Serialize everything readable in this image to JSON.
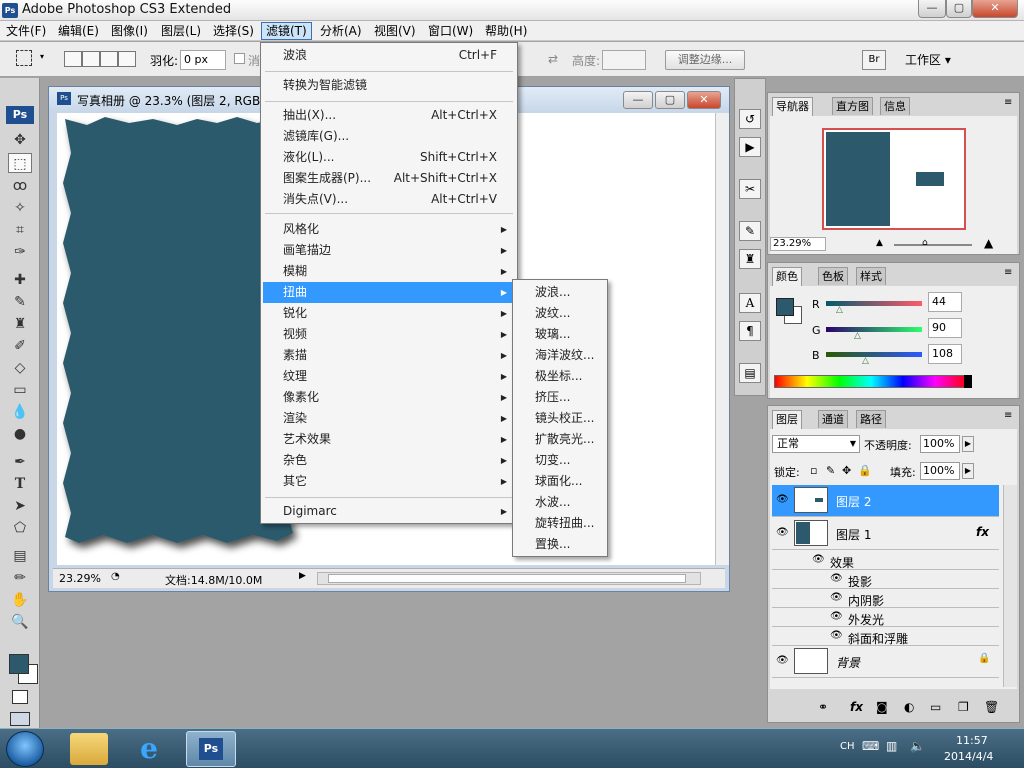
{
  "app": {
    "title": "Adobe Photoshop CS3 Extended",
    "logo": "Ps"
  },
  "window_controls": {
    "minimize": "—",
    "maximize": "▢",
    "close": "✕"
  },
  "menubar": [
    "文件(F)",
    "编辑(E)",
    "图像(I)",
    "图层(L)",
    "选择(S)",
    "滤镜(T)",
    "分析(A)",
    "视图(V)",
    "窗口(W)",
    "帮助(H)"
  ],
  "options": {
    "feather_label": "羽化:",
    "feather_value": "0 px",
    "antialias": "消",
    "height_label": "高度:",
    "refine_edge": "调整边缘...",
    "workspace": "工作区 ▾"
  },
  "document": {
    "title": "写真相册 @ 23.3% (图层 2, RGB/",
    "zoom": "23.29%",
    "doc_info": "文档:14.8M/10.0M",
    "canvas_color": "#2c5a6c"
  },
  "filter_menu": {
    "last_filter": {
      "label": "波浪",
      "shortcut": "Ctrl+F"
    },
    "smart": "转换为智能滤镜",
    "group1": [
      {
        "label": "抽出(X)...",
        "shortcut": "Alt+Ctrl+X"
      },
      {
        "label": "滤镜库(G)...",
        "shortcut": ""
      },
      {
        "label": "液化(L)...",
        "shortcut": "Shift+Ctrl+X"
      },
      {
        "label": "图案生成器(P)...",
        "shortcut": "Alt+Shift+Ctrl+X"
      },
      {
        "label": "消失点(V)...",
        "shortcut": "Alt+Ctrl+V"
      }
    ],
    "group2": [
      "风格化",
      "画笔描边",
      "模糊",
      "扭曲",
      "锐化",
      "视频",
      "素描",
      "纹理",
      "像素化",
      "渲染",
      "艺术效果",
      "杂色",
      "其它"
    ],
    "highlighted": "扭曲",
    "digimarc": "Digimarc"
  },
  "distort_submenu": [
    "波浪...",
    "波纹...",
    "玻璃...",
    "海洋波纹...",
    "极坐标...",
    "挤压...",
    "镜头校正...",
    "扩散亮光...",
    "切变...",
    "球面化...",
    "水波...",
    "旋转扭曲...",
    "置换..."
  ],
  "navigator": {
    "tabs": [
      "导航器",
      "直方图",
      "信息"
    ],
    "zoom": "23.29%"
  },
  "color_panel": {
    "tabs": [
      "颜色",
      "色板",
      "样式"
    ],
    "r_label": "R",
    "g_label": "G",
    "b_label": "B",
    "r": "44",
    "g": "90",
    "b": "108",
    "swatch": "#2c5a6c"
  },
  "layers_panel": {
    "tabs": [
      "图层",
      "通道",
      "路径"
    ],
    "blend_mode": "正常",
    "opacity_label": "不透明度:",
    "opacity": "100%",
    "lock_label": "锁定:",
    "fill_label": "填充:",
    "fill": "100%",
    "layers": [
      {
        "name": "图层 2",
        "selected": true
      },
      {
        "name": "图层 1",
        "fx": "fx"
      }
    ],
    "effects_label": "效果",
    "effects": [
      "投影",
      "内阴影",
      "外发光",
      "斜面和浮雕"
    ],
    "background": "背景"
  },
  "taskbar": {
    "lang": "CH",
    "time": "11:57",
    "date": "2014/4/4",
    "ps_label": "Ps"
  },
  "colors": {
    "accent": "#3399ff",
    "selected_layer": "#3399ff",
    "canvas": "#2c5a6c"
  }
}
